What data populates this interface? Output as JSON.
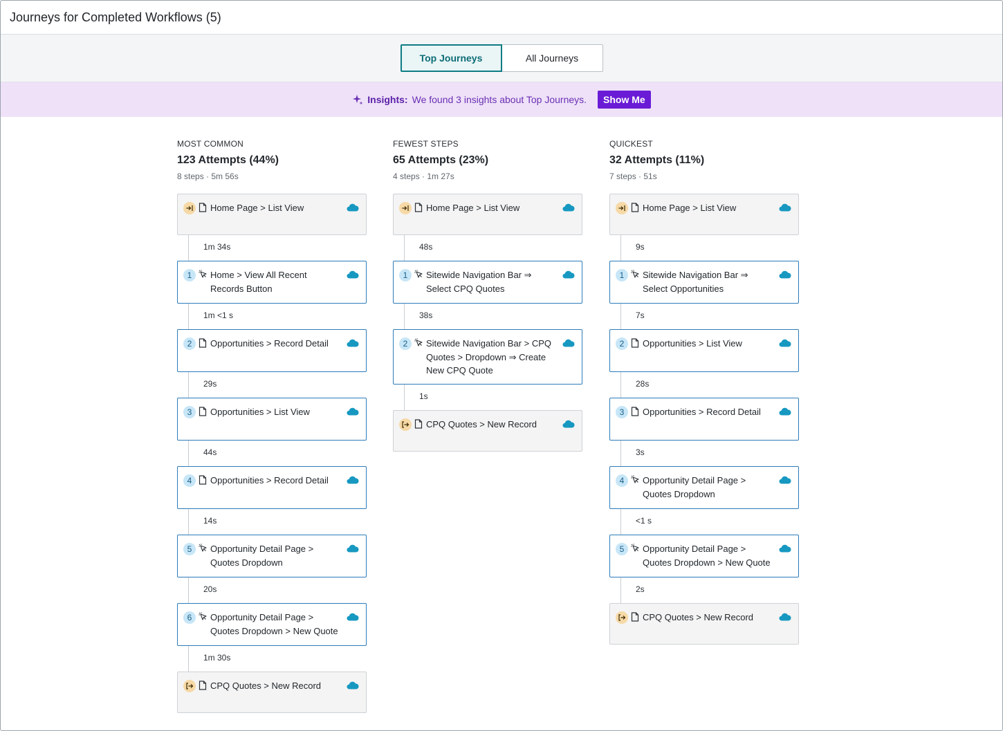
{
  "header": {
    "title": "Journeys for Completed Workflows (5)"
  },
  "tabs": [
    {
      "label": "Top Journeys",
      "active": true
    },
    {
      "label": "All Journeys",
      "active": false
    }
  ],
  "insights": {
    "icon": "sparkle-icon",
    "prefix": "Insights:",
    "message": "We found 3 insights about Top Journeys.",
    "button": "Show Me"
  },
  "colors": {
    "accent": "#0c7c84",
    "insights_bg": "#eee1f8",
    "insights_button": "#6a1bd6",
    "step_border": "#2c7bb9",
    "salesforce_cloud": "#1798c1"
  },
  "journeys": [
    {
      "label": "MOST COMMON",
      "attempts": "123 Attempts (44%)",
      "meta": "8 steps · 5m 56s",
      "steps": [
        {
          "type": "start",
          "icon": "page",
          "text": "Home Page > List View"
        },
        {
          "gap": "1m 34s",
          "badge": "1",
          "icon": "click",
          "text": "Home > View All Recent Records Button"
        },
        {
          "gap": "1m <1 s",
          "badge": "2",
          "icon": "page",
          "text": "Opportunities > Record Detail"
        },
        {
          "gap": "29s",
          "badge": "3",
          "icon": "page",
          "text": "Opportunities > List View"
        },
        {
          "gap": "44s",
          "badge": "4",
          "icon": "page",
          "text": "Opportunities > Record Detail"
        },
        {
          "gap": "14s",
          "badge": "5",
          "icon": "click",
          "text": "Opportunity Detail Page > Quotes Dropdown"
        },
        {
          "gap": "20s",
          "badge": "6",
          "icon": "click",
          "text": "Opportunity Detail Page > Quotes Dropdown > New Quote"
        },
        {
          "gap": "1m 30s",
          "type": "end",
          "icon": "page",
          "text": "CPQ Quotes > New Record"
        }
      ]
    },
    {
      "label": "FEWEST STEPS",
      "attempts": "65 Attempts (23%)",
      "meta": "4 steps · 1m 27s",
      "steps": [
        {
          "type": "start",
          "icon": "page",
          "text": "Home Page > List View"
        },
        {
          "gap": "48s",
          "badge": "1",
          "icon": "click",
          "text": "Sitewide Navigation Bar ⇒ Select CPQ Quotes"
        },
        {
          "gap": "38s",
          "badge": "2",
          "icon": "click",
          "text": "Sitewide Navigation Bar > CPQ Quotes > Dropdown ⇒ Create New CPQ Quote"
        },
        {
          "gap": "1s",
          "type": "end",
          "icon": "page",
          "text": "CPQ Quotes > New Record"
        }
      ]
    },
    {
      "label": "QUICKEST",
      "attempts": "32 Attempts (11%)",
      "meta": "7 steps · 51s",
      "steps": [
        {
          "type": "start",
          "icon": "page",
          "text": "Home Page > List View"
        },
        {
          "gap": "9s",
          "badge": "1",
          "icon": "click",
          "text": "Sitewide Navigation Bar ⇒ Select Opportunities"
        },
        {
          "gap": "7s",
          "badge": "2",
          "icon": "page",
          "text": "Opportunities > List View"
        },
        {
          "gap": "28s",
          "badge": "3",
          "icon": "page",
          "text": "Opportunities > Record Detail"
        },
        {
          "gap": "3s",
          "badge": "4",
          "icon": "click",
          "text": "Opportunity Detail Page > Quotes Dropdown"
        },
        {
          "gap": "<1 s",
          "badge": "5",
          "icon": "click",
          "text": "Opportunity Detail Page > Quotes Dropdown > New Quote"
        },
        {
          "gap": "2s",
          "type": "end",
          "icon": "page",
          "text": "CPQ Quotes > New Record"
        }
      ]
    }
  ]
}
